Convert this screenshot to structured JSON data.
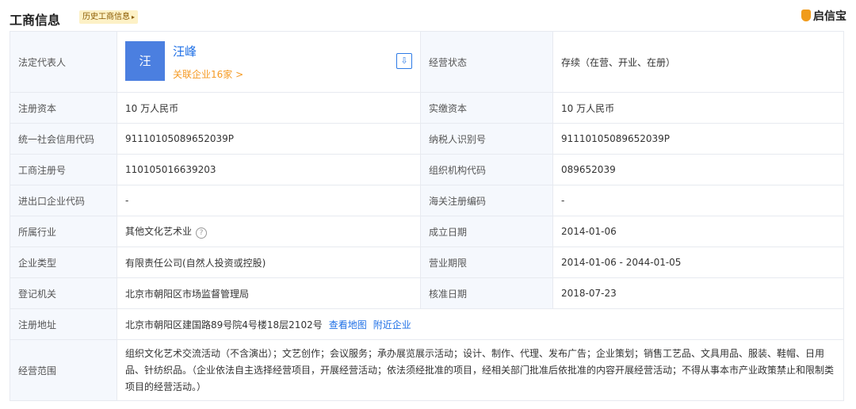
{
  "header": {
    "title": "工商信息",
    "history_tag": "历史工商信息",
    "brand": "启信宝"
  },
  "legal": {
    "label": "法定代表人",
    "avatar_char": "汪",
    "name": "汪峰",
    "related": "关联企业16家 >",
    "status_label": "经营状态",
    "status_value": "存续（在营、开业、在册）"
  },
  "rows": [
    {
      "l1": "注册资本",
      "v1": "10 万人民币",
      "l2": "实缴资本",
      "v2": "10 万人民币"
    },
    {
      "l1": "统一社会信用代码",
      "v1": "91110105089652039P",
      "l2": "纳税人识别号",
      "v2": "91110105089652039P"
    },
    {
      "l1": "工商注册号",
      "v1": "110105016639203",
      "l2": "组织机构代码",
      "v2": "089652039"
    },
    {
      "l1": "进出口企业代码",
      "v1": "-",
      "l2": "海关注册编码",
      "v2": "-"
    },
    {
      "l1": "所属行业",
      "v1": "其他文化艺术业",
      "l2": "成立日期",
      "v2": "2014-01-06"
    },
    {
      "l1": "企业类型",
      "v1": "有限责任公司(自然人投资或控股)",
      "l2": "营业期限",
      "v2": "2014-01-06 - 2044-01-05"
    },
    {
      "l1": "登记机关",
      "v1": "北京市朝阳区市场监督管理局",
      "l2": "核准日期",
      "v2": "2018-07-23"
    }
  ],
  "address": {
    "label": "注册地址",
    "value": "北京市朝阳区建国路89号院4号楼18层2102号",
    "map_link": "查看地图",
    "nearby_link": "附近企业"
  },
  "scope": {
    "label": "经营范围",
    "value": "组织文化艺术交流活动（不含演出）；文艺创作；会议服务；承办展览展示活动；设计、制作、代理、发布广告；企业策划；销售工艺品、文具用品、服装、鞋帽、日用品、针纺织品。（企业依法自主选择经营项目，开展经营活动；依法须经批准的项目，经相关部门批准后依批准的内容开展经营活动；不得从事本市产业政策禁止和限制类项目的经营活动。）"
  }
}
